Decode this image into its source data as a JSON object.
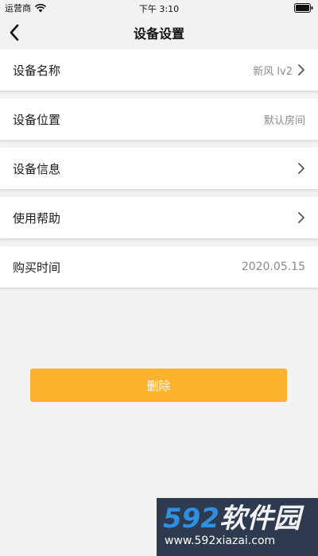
{
  "status_bar": {
    "carrier": "运营商",
    "time": "下午 3:10"
  },
  "nav": {
    "title": "设备设置",
    "back_icon": "chevron-left-icon"
  },
  "rows": [
    {
      "label": "设备名称",
      "value": "新风 lv2",
      "has_chevron": true
    },
    {
      "label": "设备位置",
      "value": "默认房间",
      "has_chevron": false
    },
    {
      "label": "设备信息",
      "value": "",
      "has_chevron": true
    },
    {
      "label": "使用帮助",
      "value": "",
      "has_chevron": true
    },
    {
      "label": "购买时间",
      "value": "2020.05.15",
      "has_chevron": false
    }
  ],
  "delete_button": {
    "label": "删除",
    "color": "#fbb22c"
  },
  "watermark": {
    "logo_num": "592",
    "logo_cn": "软件园",
    "url": "www.592xiazai.com"
  },
  "colors": {
    "background": "#f2f2f2",
    "accent": "#fbb22c"
  }
}
